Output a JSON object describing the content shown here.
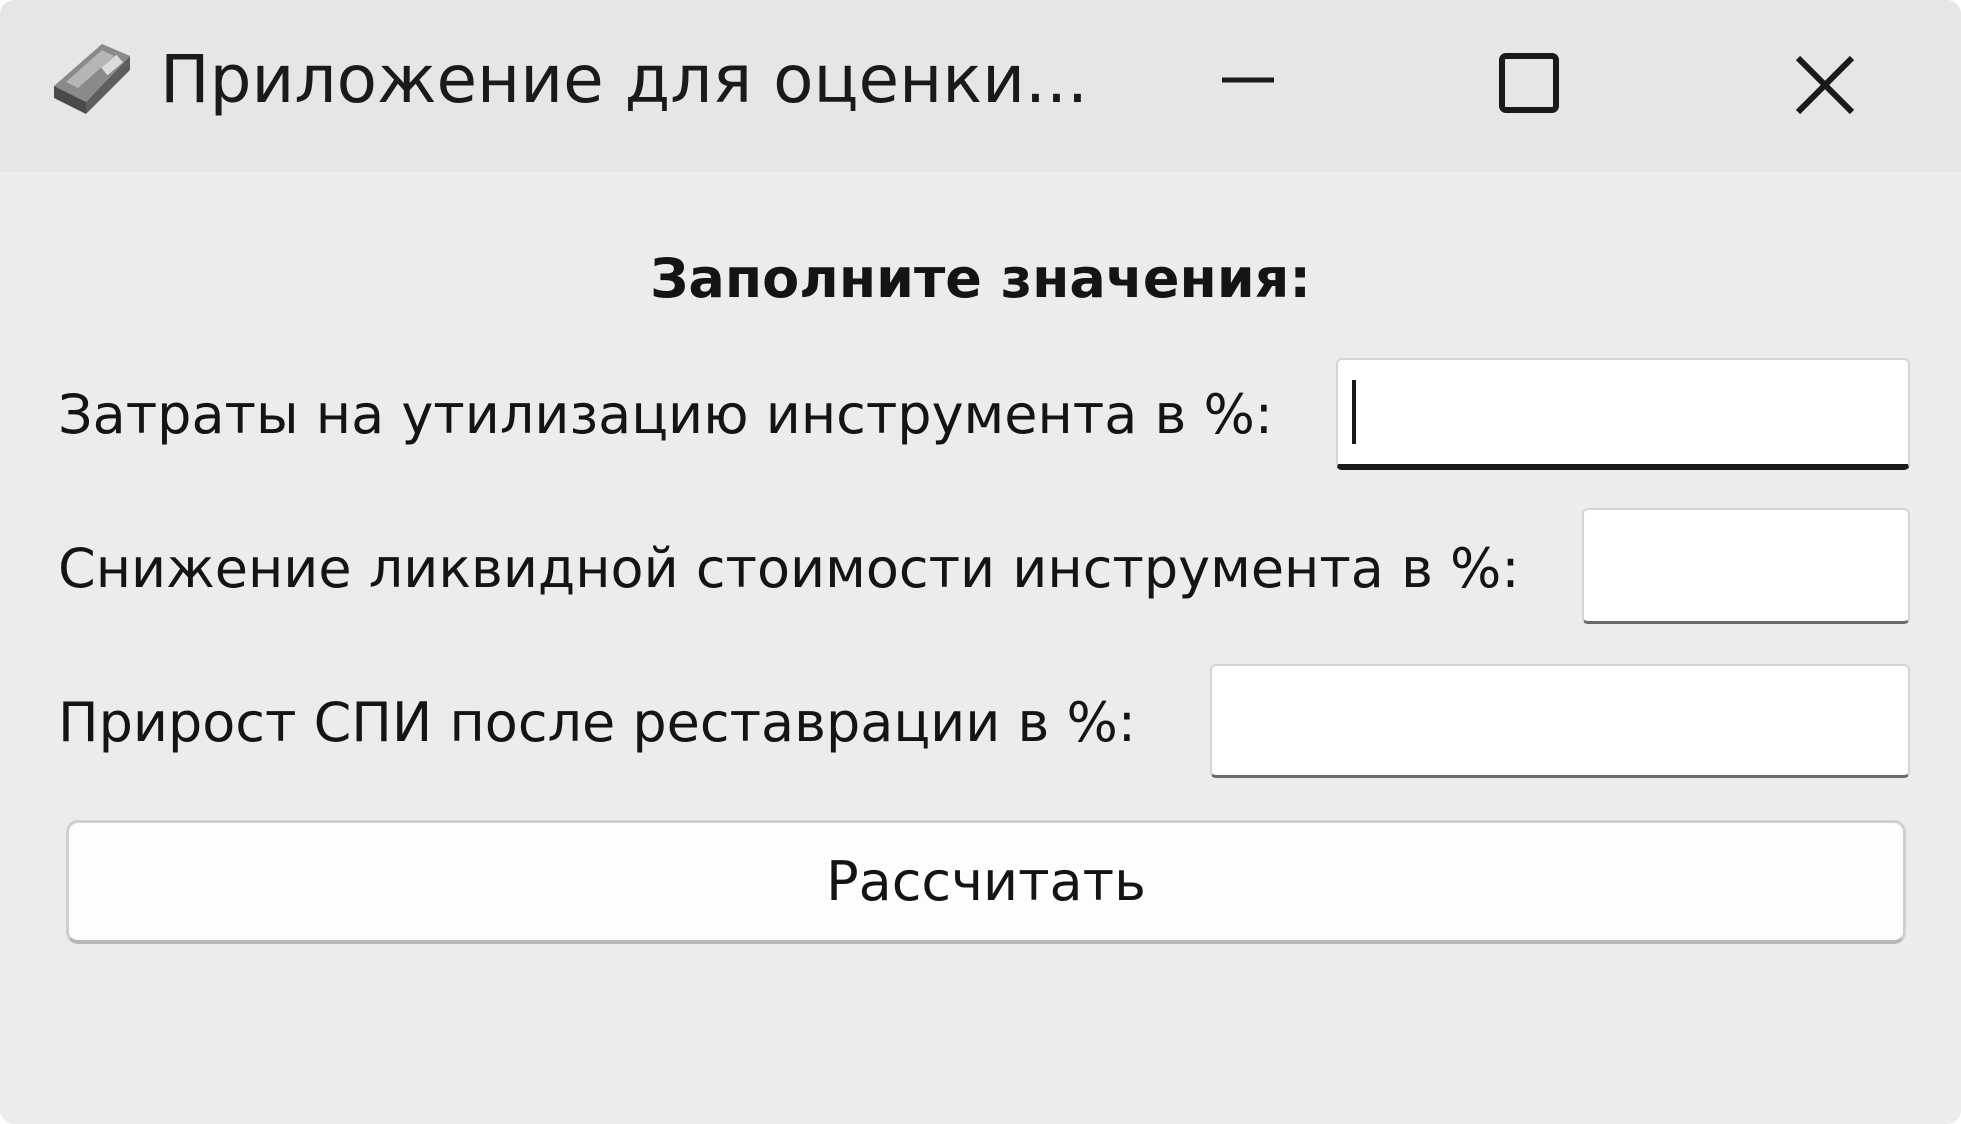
{
  "window": {
    "title": "Приложение для оценки...",
    "app_icon": "tool-icon",
    "controls": {
      "minimize_icon": "minimize-icon",
      "maximize_icon": "maximize-icon",
      "close_icon": "close-icon"
    }
  },
  "form": {
    "heading": "Заполните значения:",
    "fields": [
      {
        "label": "Затраты на утилизацию инструмента в %:",
        "value": ""
      },
      {
        "label": "Снижение ликвидной стоимости инструмента в %:",
        "value": ""
      },
      {
        "label": "Прирост СПИ после реставрации в %:",
        "value": ""
      }
    ],
    "submit_label": "Рассчитать"
  },
  "colors": {
    "window_background": "#ececec",
    "titlebar_background": "#e6e6e6",
    "input_background": "#ffffff",
    "text": "#141414"
  }
}
